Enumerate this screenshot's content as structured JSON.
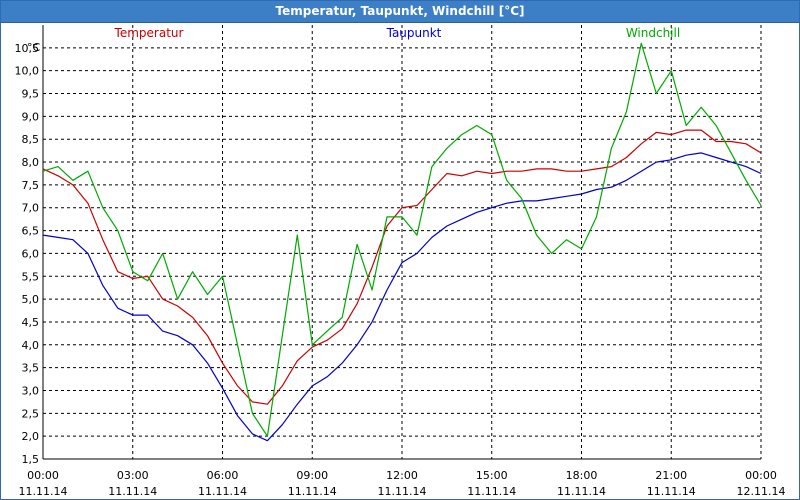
{
  "window": {
    "title": "Temperatur, Taupunkt, Windchill [°C]"
  },
  "chart_data": {
    "type": "line",
    "title": "Temperatur, Taupunkt, Windchill [°C]",
    "ylabel": "°C",
    "ylim": [
      1.5,
      11
    ],
    "xlim": [
      0,
      24
    ],
    "grid": true,
    "legend_placement": "top",
    "y_ticks": [
      "1,5",
      "2,0",
      "2,5",
      "3,0",
      "3,5",
      "4,0",
      "4,5",
      "5,0",
      "5,5",
      "6,0",
      "6,5",
      "7,0",
      "7,5",
      "8,0",
      "8,5",
      "9,0",
      "9,5",
      "10,0",
      "10,5"
    ],
    "x_ticks": [
      {
        "time": "00:00",
        "date": "11.11.14"
      },
      {
        "time": "03:00",
        "date": "11.11.14"
      },
      {
        "time": "06:00",
        "date": "11.11.14"
      },
      {
        "time": "09:00",
        "date": "11.11.14"
      },
      {
        "time": "12:00",
        "date": "11.11.14"
      },
      {
        "time": "15:00",
        "date": "11.11.14"
      },
      {
        "time": "18:00",
        "date": "11.11.14"
      },
      {
        "time": "21:00",
        "date": "11.11.14"
      },
      {
        "time": "00:00",
        "date": "12.11.14"
      }
    ],
    "x": [
      0,
      0.5,
      1,
      1.5,
      2,
      2.5,
      3,
      3.5,
      4,
      4.5,
      5,
      5.5,
      6,
      6.5,
      7,
      7.5,
      8,
      8.5,
      9,
      9.5,
      10,
      10.5,
      11,
      11.5,
      12,
      12.5,
      13,
      13.5,
      14,
      14.5,
      15,
      15.5,
      16,
      16.5,
      17,
      17.5,
      18,
      18.5,
      19,
      19.5,
      20,
      20.5,
      21,
      21.5,
      22,
      22.5,
      23,
      23.5,
      24
    ],
    "series": [
      {
        "name": "Temperatur",
        "color": "#cc0000",
        "values": [
          7.85,
          7.7,
          7.5,
          7.1,
          6.3,
          5.6,
          5.45,
          5.5,
          5.0,
          4.85,
          4.6,
          4.2,
          3.6,
          3.1,
          2.75,
          2.7,
          3.1,
          3.65,
          3.95,
          4.1,
          4.35,
          4.9,
          5.7,
          6.6,
          7.0,
          7.05,
          7.4,
          7.75,
          7.7,
          7.8,
          7.75,
          7.8,
          7.8,
          7.85,
          7.85,
          7.8,
          7.8,
          7.85,
          7.9,
          8.1,
          8.4,
          8.65,
          8.6,
          8.7,
          8.7,
          8.45,
          8.45,
          8.4,
          8.2
        ]
      },
      {
        "name": "Taupunkt",
        "color": "#0000cc",
        "values": [
          6.4,
          6.35,
          6.3,
          6.0,
          5.3,
          4.8,
          4.65,
          4.65,
          4.3,
          4.2,
          4.0,
          3.6,
          3.05,
          2.45,
          2.05,
          1.9,
          2.25,
          2.7,
          3.1,
          3.3,
          3.6,
          4.0,
          4.5,
          5.2,
          5.8,
          6.0,
          6.35,
          6.6,
          6.75,
          6.9,
          7.0,
          7.1,
          7.15,
          7.15,
          7.2,
          7.25,
          7.3,
          7.4,
          7.45,
          7.6,
          7.8,
          8.0,
          8.05,
          8.15,
          8.2,
          8.1,
          8.0,
          7.9,
          7.75
        ]
      },
      {
        "name": "Windchill",
        "color": "#00aa00",
        "values": [
          7.8,
          7.9,
          7.6,
          7.8,
          7.0,
          6.5,
          5.6,
          5.4,
          6.0,
          5.0,
          5.6,
          5.1,
          5.5,
          4.0,
          2.5,
          2.0,
          4.2,
          6.4,
          4.0,
          4.3,
          4.6,
          6.2,
          5.2,
          6.8,
          6.8,
          6.4,
          7.9,
          8.3,
          8.6,
          8.8,
          8.6,
          7.6,
          7.2,
          6.4,
          6.0,
          6.3,
          6.1,
          6.8,
          8.3,
          9.1,
          10.6,
          9.5,
          10.0,
          8.8,
          9.2,
          8.8,
          8.2,
          7.6,
          7.05
        ]
      }
    ]
  }
}
